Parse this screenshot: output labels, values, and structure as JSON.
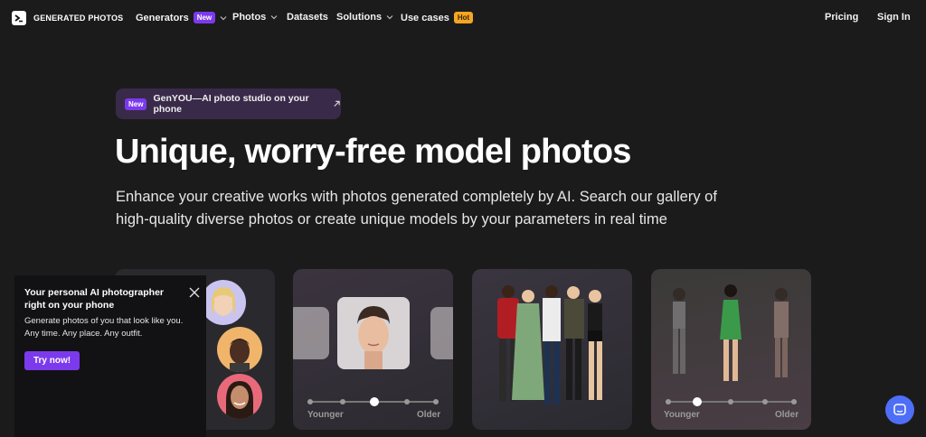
{
  "nav": {
    "logo_text": "GENERATED PHOTOS",
    "items": [
      {
        "label": "Generators",
        "badge": "New"
      },
      {
        "label": "Photos"
      },
      {
        "label": "Datasets"
      },
      {
        "label": "Solutions"
      },
      {
        "label": "Use cases",
        "badge": "Hot"
      }
    ],
    "pricing": "Pricing",
    "signin": "Sign In"
  },
  "hero": {
    "pill_badge": "New",
    "pill_text": "GenYOU—AI photo studio on your phone",
    "title": "Unique, worry-free model photos",
    "subtitle_line1": "Enhance your creative works with photos generated completely by AI. Search our gallery of",
    "subtitle_line2": "high-quality diverse photos or create unique models by your parameters in real time"
  },
  "cards": {
    "age_slider": {
      "left_label": "Younger",
      "right_label": "Older"
    },
    "body_slider": {
      "left_label": "Younger",
      "right_label": "Older"
    }
  },
  "popup": {
    "title": "Your personal AI photographer right on your phone",
    "text": "Generate photos of you that look like you. Any time. Any place. Any outfit.",
    "button": "Try now!"
  },
  "colors": {
    "accent": "#7c3aed",
    "hot": "#f5a623",
    "chat": "#4f6ef7",
    "background": "#1b1b1c"
  }
}
